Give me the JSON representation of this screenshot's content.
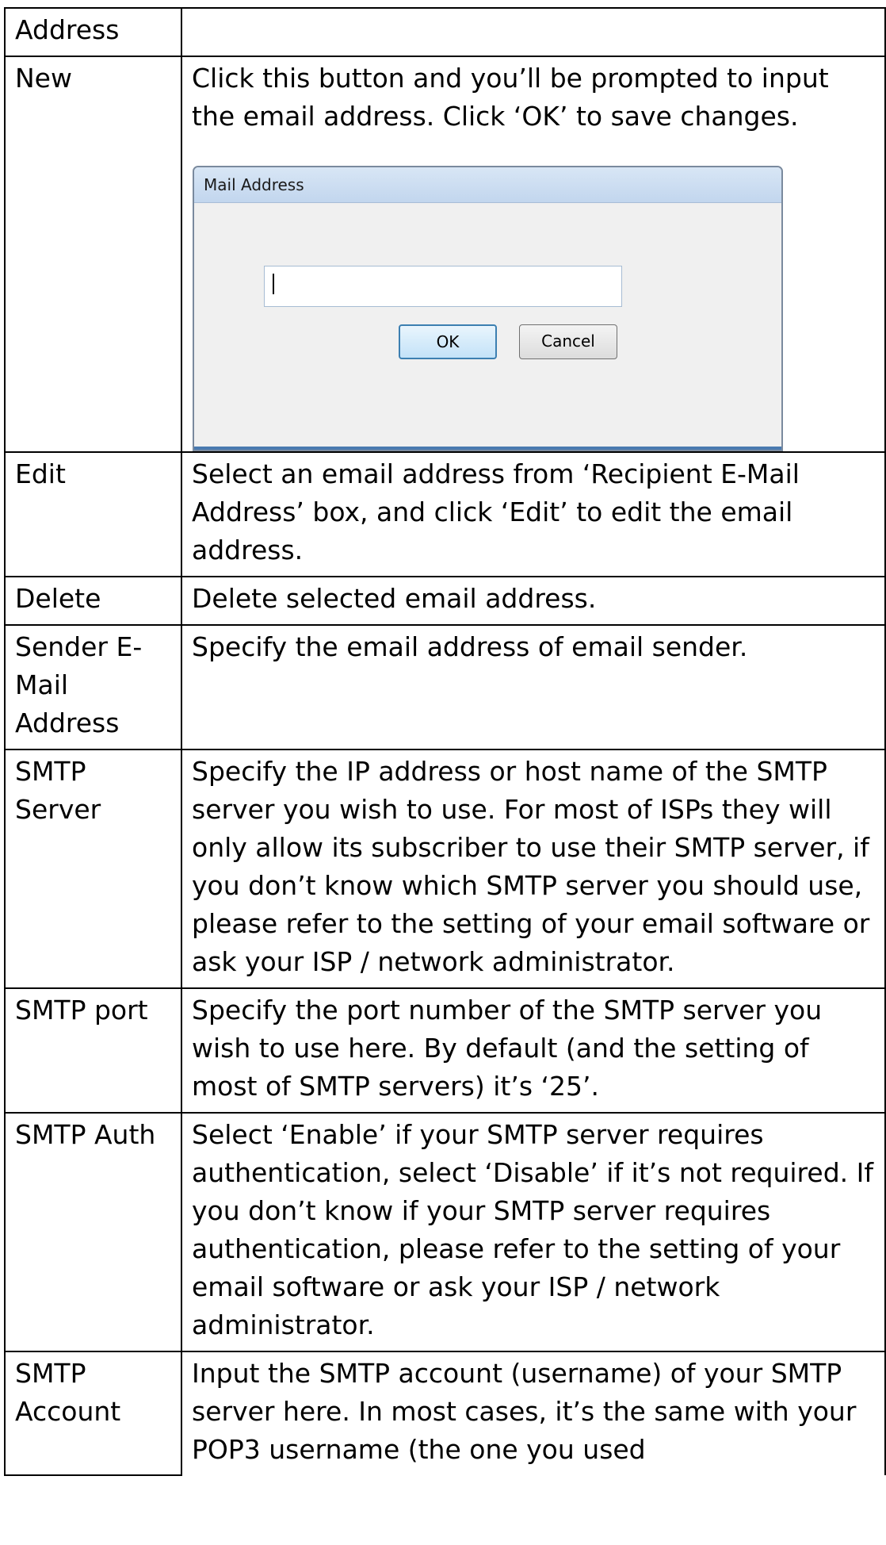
{
  "rows": [
    {
      "term": "Address",
      "desc": ""
    },
    {
      "term": "New",
      "desc": "Click this button and you’ll be prompted to input the email address. Click ‘OK’ to save changes."
    },
    {
      "term": "Edit",
      "desc": "Select an email address from ‘Recipient E-Mail Address’ box, and click ‘Edit’ to edit the email address."
    },
    {
      "term": "Delete",
      "desc": "Delete selected email address."
    },
    {
      "term": "Sender E-Mail Address",
      "desc": "Specify the email address of email sender."
    },
    {
      "term": "SMTP Server",
      "desc": "Specify the IP address or host name of the SMTP server you wish to use. For most of ISPs they will only allow its subscriber to use their SMTP server, if you don’t know which SMTP server you should use, please refer to the setting of your email software or ask your ISP / network administrator."
    },
    {
      "term": "SMTP port",
      "desc": "Specify the port number of the SMTP server you wish to use here. By default (and the setting of most of SMTP servers) it’s ‘25’."
    },
    {
      "term": "SMTP Auth",
      "desc": "Select ‘Enable’ if your SMTP server requires authentication, select ‘Disable’ if it’s not required. If you don’t know if your SMTP server requires authentication, please refer to the setting of your email software or ask your ISP / network administrator."
    },
    {
      "term": "SMTP Account",
      "desc": "Input the SMTP account (username) of your SMTP server here. In most cases, it’s the same with your POP3 username (the one you used"
    }
  ],
  "dialog": {
    "title": "Mail Address",
    "input_value": "",
    "ok_label": "OK",
    "cancel_label": "Cancel"
  }
}
